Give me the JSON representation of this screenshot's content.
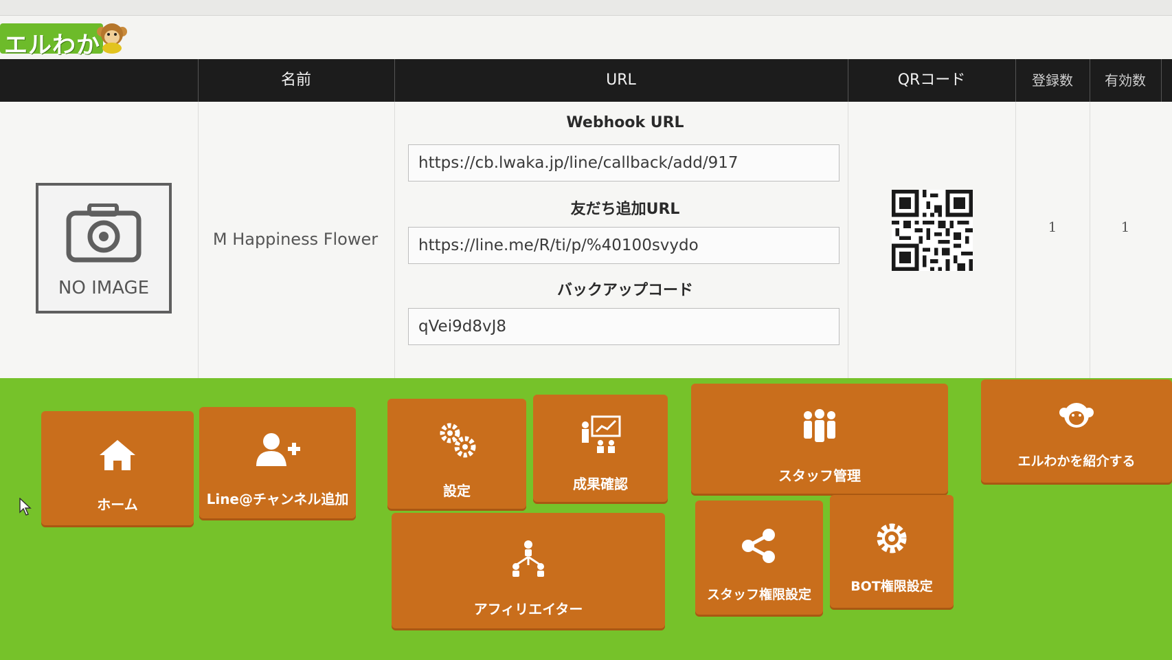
{
  "logo": {
    "text": "エルわか"
  },
  "table": {
    "headers": [
      "名前",
      "URL",
      "QRコード",
      "登録数",
      "有効数"
    ],
    "row": {
      "image_label": "NO IMAGE",
      "name": "M Happiness Flower",
      "webhook_label": "Webhook URL",
      "webhook_url": "https://cb.lwaka.jp/line/callback/add/917",
      "friend_label": "友だち追加URL",
      "friend_url": "https://line.me/R/ti/p/%40100svydo",
      "backup_label": "バックアップコード",
      "backup_code": "qVei9d8vJ8",
      "registrations": "1",
      "active": "1"
    }
  },
  "menu": {
    "home": "ホーム",
    "add_channel": "Line@チャンネル追加",
    "settings": "設定",
    "results": "成果確認",
    "staff": "スタッフ管理",
    "introduce": "エルわかを紹介する",
    "affiliate": "アフィリエイター",
    "staff_perm": "スタッフ権限設定",
    "bot_perm": "BOT権限設定"
  },
  "colors": {
    "menu_bg": "#76c22a",
    "tile": "#c96e1c",
    "header": "#1c1c1c"
  }
}
